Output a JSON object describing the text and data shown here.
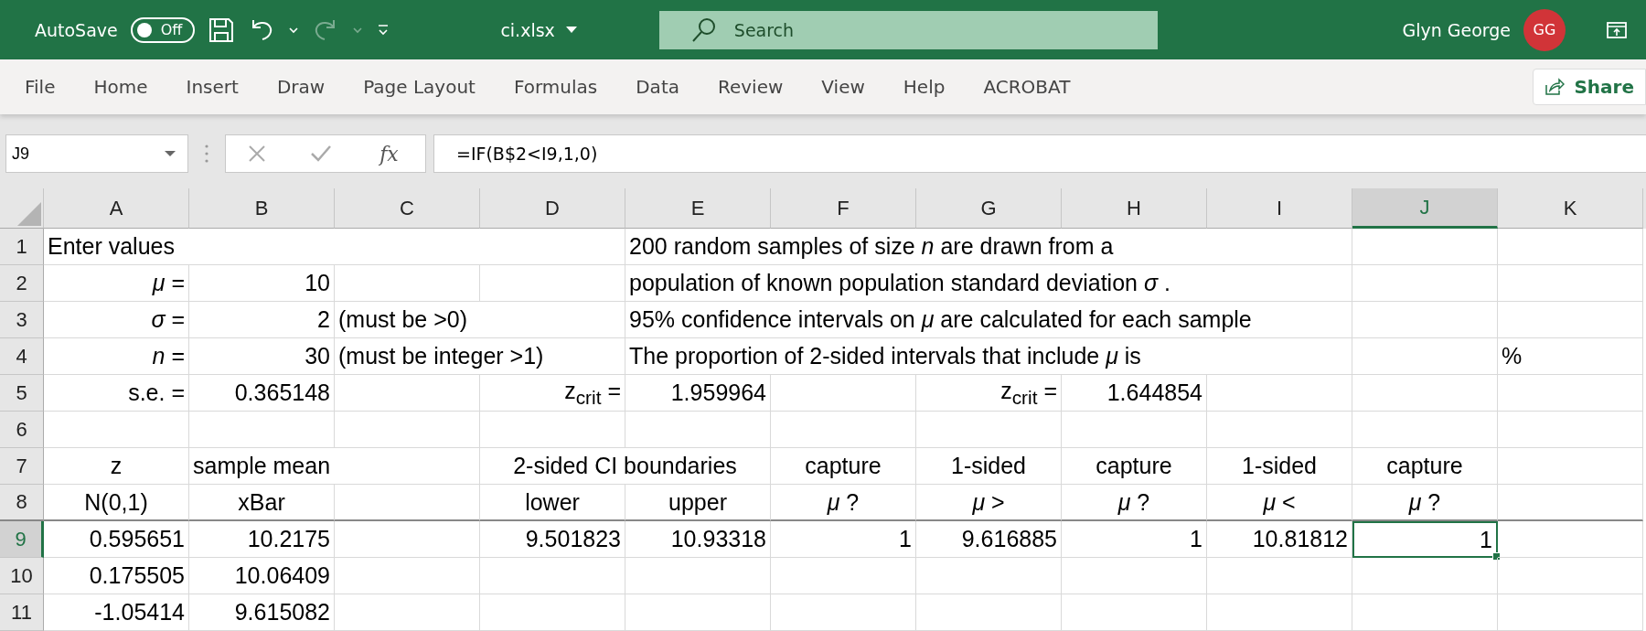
{
  "title_bar": {
    "autosave_label": "AutoSave",
    "autosave_toggle": {
      "text": "Off",
      "on": false
    },
    "redo_disabled": true,
    "file_name": "ci.xlsx",
    "search": {
      "placeholder": "Search"
    },
    "user_name": "Glyn George",
    "avatar_initials": "GG"
  },
  "ribbon_tabs": [
    {
      "label": "File",
      "selected": false
    },
    {
      "label": "Home",
      "selected": false
    },
    {
      "label": "Insert",
      "selected": false
    },
    {
      "label": "Draw",
      "selected": false
    },
    {
      "label": "Page Layout",
      "selected": false
    },
    {
      "label": "Formulas",
      "selected": false
    },
    {
      "label": "Data",
      "selected": false
    },
    {
      "label": "Review",
      "selected": false
    },
    {
      "label": "View",
      "selected": false
    },
    {
      "label": "Help",
      "selected": false
    },
    {
      "label": "ACROBAT",
      "selected": false
    }
  ],
  "share_button": "Share",
  "formula_bar": {
    "name_box": "J9",
    "fx": "fx",
    "formula": "=IF(B$2<I9,1,0)"
  },
  "columns": [
    {
      "label": "A",
      "selected": false
    },
    {
      "label": "B",
      "selected": false
    },
    {
      "label": "C",
      "selected": false
    },
    {
      "label": "D",
      "selected": false
    },
    {
      "label": "E",
      "selected": false
    },
    {
      "label": "F",
      "selected": false
    },
    {
      "label": "G",
      "selected": false
    },
    {
      "label": "H",
      "selected": false
    },
    {
      "label": "I",
      "selected": false
    },
    {
      "label": "J",
      "selected": true
    },
    {
      "label": "K",
      "selected": false
    }
  ],
  "rows": [
    {
      "number": "1",
      "selected": false,
      "cells": {
        "A": {
          "kind": "text",
          "text": "Enter values",
          "selected": false
        },
        "E": {
          "kind": "text",
          "text": "200 random samples of size *n* are drawn from a",
          "selected": false
        }
      }
    },
    {
      "number": "2",
      "selected": false,
      "cells": {
        "A": {
          "kind": "label",
          "text": "*μ* =",
          "selected": false
        },
        "B": {
          "kind": "number",
          "text": "10",
          "selected": false
        },
        "E": {
          "kind": "text",
          "text": "population of known population standard deviation *σ* .",
          "selected": false
        }
      }
    },
    {
      "number": "3",
      "selected": false,
      "cells": {
        "A": {
          "kind": "label",
          "text": "*σ* =",
          "selected": false
        },
        "B": {
          "kind": "number",
          "text": "2",
          "selected": false
        },
        "C": {
          "kind": "text",
          "text": "(must be >0)",
          "selected": false
        },
        "E": {
          "kind": "text",
          "text": "95% confidence intervals on *μ* are calculated for each sample",
          "selected": false
        }
      }
    },
    {
      "number": "4",
      "selected": false,
      "cells": {
        "A": {
          "kind": "label",
          "text": "*n* =",
          "selected": false
        },
        "B": {
          "kind": "number",
          "text": "30",
          "selected": false
        },
        "C": {
          "kind": "text",
          "text": "(must be integer >1)",
          "selected": false
        },
        "E": {
          "kind": "text",
          "text": "The proportion of 2-sided intervals that include *μ* is",
          "selected": false
        },
        "K": {
          "kind": "text",
          "text": "%",
          "selected": false
        }
      }
    },
    {
      "number": "5",
      "selected": false,
      "cells": {
        "A": {
          "kind": "label",
          "text": "s.e. =",
          "selected": false
        },
        "B": {
          "kind": "number",
          "text": "0.365148",
          "selected": false
        },
        "D": {
          "kind": "label",
          "text": "z$_{crit}$ =",
          "selected": false
        },
        "E": {
          "kind": "number",
          "text": "1.959964",
          "selected": false
        },
        "G": {
          "kind": "label",
          "text": "z$_{crit}$ =",
          "selected": false
        },
        "H": {
          "kind": "number",
          "text": "1.644854",
          "selected": false
        }
      }
    },
    {
      "number": "6",
      "selected": false,
      "cells": {}
    },
    {
      "number": "7",
      "selected": false,
      "cells": {
        "A": {
          "kind": "heading",
          "text": "z",
          "selected": false
        },
        "B": {
          "kind": "text",
          "text": "sample mean",
          "selected": false
        },
        "D": {
          "kind": "wide-heading",
          "text": "2-sided CI boundaries",
          "selected": false
        },
        "F": {
          "kind": "heading",
          "text": "capture",
          "selected": false
        },
        "G": {
          "kind": "heading",
          "text": "1-sided",
          "selected": false
        },
        "H": {
          "kind": "heading",
          "text": "capture",
          "selected": false
        },
        "I": {
          "kind": "heading",
          "text": "1-sided",
          "selected": false
        },
        "J": {
          "kind": "heading",
          "text": "capture",
          "selected": false
        }
      }
    },
    {
      "number": "8",
      "selected": false,
      "cells": {
        "A": {
          "kind": "heading",
          "text": "N(0,1)",
          "selected": false
        },
        "B": {
          "kind": "heading",
          "text": "xBar",
          "selected": false
        },
        "D": {
          "kind": "heading",
          "text": "lower",
          "selected": false
        },
        "E": {
          "kind": "heading",
          "text": "upper",
          "selected": false
        },
        "F": {
          "kind": "heading",
          "text": "*μ* ?",
          "selected": false
        },
        "G": {
          "kind": "heading",
          "text": "*μ* >",
          "selected": false
        },
        "H": {
          "kind": "heading",
          "text": "*μ* ?",
          "selected": false
        },
        "I": {
          "kind": "heading",
          "text": "*μ* <",
          "selected": false
        },
        "J": {
          "kind": "heading",
          "text": "*μ* ?",
          "selected": false
        }
      }
    },
    {
      "number": "9",
      "selected": true,
      "cells": {
        "A": {
          "kind": "number",
          "text": "0.595651",
          "selected": false
        },
        "B": {
          "kind": "number",
          "text": "10.2175",
          "selected": false
        },
        "D": {
          "kind": "number",
          "text": "9.501823",
          "selected": false
        },
        "E": {
          "kind": "number",
          "text": "10.93318",
          "selected": false
        },
        "F": {
          "kind": "number",
          "text": "1",
          "selected": false
        },
        "G": {
          "kind": "number",
          "text": "9.616885",
          "selected": false
        },
        "H": {
          "kind": "number",
          "text": "1",
          "selected": false
        },
        "I": {
          "kind": "number",
          "text": "10.81812",
          "selected": false
        },
        "J": {
          "kind": "number",
          "text": "1",
          "selected": true
        }
      }
    },
    {
      "number": "10",
      "selected": false,
      "cells": {
        "A": {
          "kind": "number",
          "text": "0.175505",
          "selected": false
        },
        "B": {
          "kind": "number",
          "text": "10.06409",
          "selected": false
        }
      }
    },
    {
      "number": "11",
      "selected": false,
      "cells": {
        "A": {
          "kind": "number",
          "text": "-1.05414",
          "selected": false
        },
        "B": {
          "kind": "number",
          "text": "9.615082",
          "selected": false
        }
      }
    }
  ]
}
